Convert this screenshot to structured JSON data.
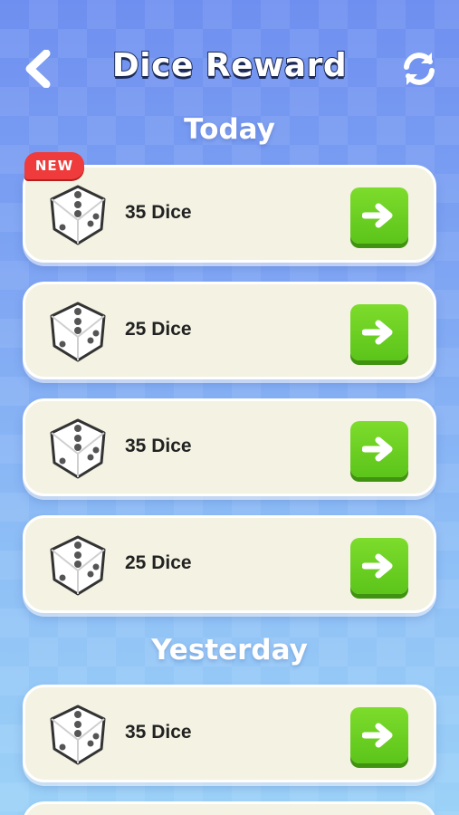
{
  "header": {
    "title": "Dice Reward",
    "back_icon": "chevron-left-icon",
    "refresh_icon": "refresh-icon"
  },
  "sections": [
    {
      "title": "Today"
    },
    {
      "title": "Yesterday"
    }
  ],
  "badge": {
    "label": "NEW"
  },
  "rewards": [
    {
      "label": "35 Dice",
      "section": "Today",
      "is_new": true
    },
    {
      "label": "25 Dice",
      "section": "Today"
    },
    {
      "label": "35 Dice",
      "section": "Today"
    },
    {
      "label": "25 Dice",
      "section": "Today"
    },
    {
      "label": "35 Dice",
      "section": "Yesterday"
    }
  ],
  "colors": {
    "card_bg": "#f4f2e2",
    "button_green": "#5cc41a",
    "badge_red": "#ef3b3b",
    "title_outline": "#1c2a55"
  }
}
